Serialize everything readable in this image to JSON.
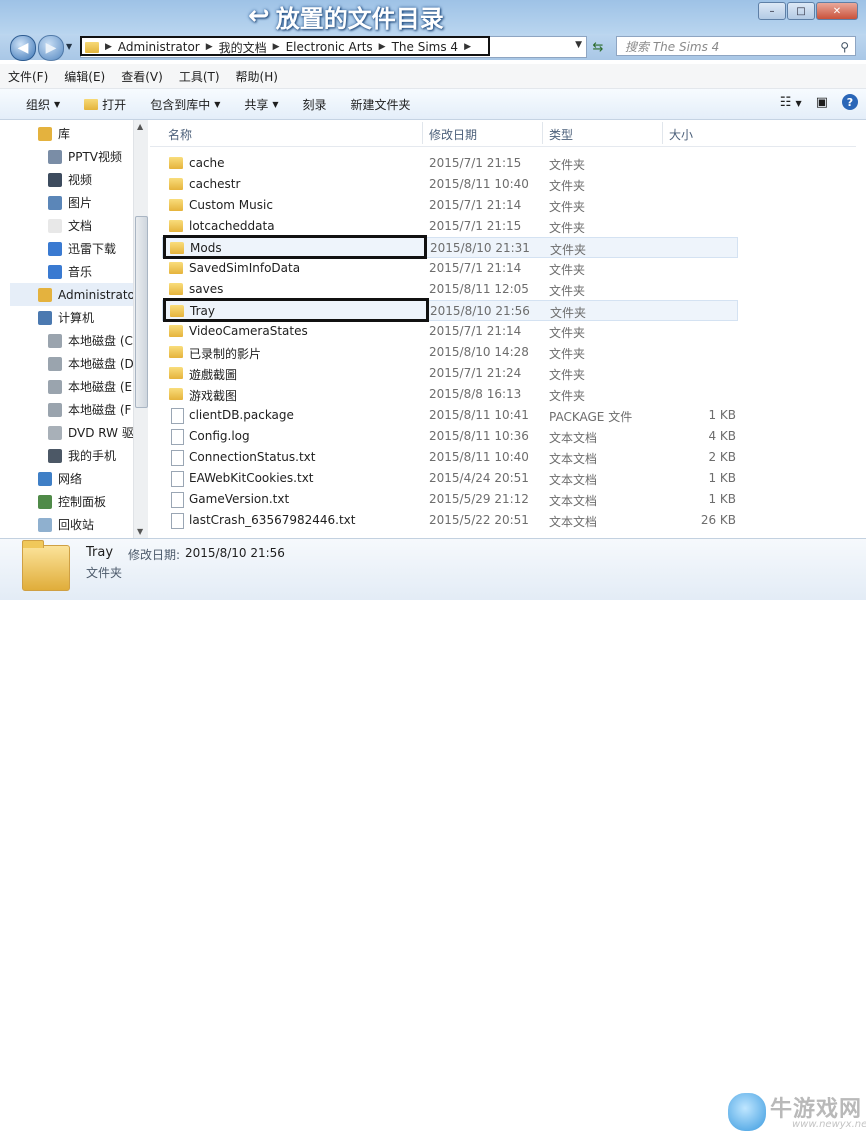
{
  "annotation_title": "放置的文件目录",
  "window_controls": {
    "minimize": "–",
    "maximize": "□",
    "close": "✕"
  },
  "address": {
    "crumbs": [
      "Administrator",
      "我的文档",
      "Electronic Arts",
      "The Sims 4"
    ]
  },
  "search": {
    "placeholder": "搜索 The Sims 4"
  },
  "menu": [
    "文件(F)",
    "编辑(E)",
    "查看(V)",
    "工具(T)",
    "帮助(H)"
  ],
  "toolbar": {
    "organize": "组织",
    "open": "打开",
    "include": "包含到库中",
    "share": "共享",
    "burn": "刻录",
    "new_folder": "新建文件夹"
  },
  "nav": [
    {
      "label": "库",
      "icon": "library-icon",
      "indent": 0
    },
    {
      "label": "PPTV视频",
      "icon": "video-library-icon",
      "indent": 1
    },
    {
      "label": "视频",
      "icon": "video-icon",
      "indent": 1
    },
    {
      "label": "图片",
      "icon": "picture-icon",
      "indent": 1
    },
    {
      "label": "文档",
      "icon": "document-icon",
      "indent": 1
    },
    {
      "label": "迅雷下载",
      "icon": "download-icon",
      "indent": 1
    },
    {
      "label": "音乐",
      "icon": "music-icon",
      "indent": 1
    },
    {
      "label": "Administrator",
      "icon": "user-folder-icon",
      "indent": 0,
      "selected": true
    },
    {
      "label": "计算机",
      "icon": "computer-icon",
      "indent": 0
    },
    {
      "label": "本地磁盘 (C",
      "icon": "drive-icon",
      "indent": 1
    },
    {
      "label": "本地磁盘 (D",
      "icon": "drive-icon",
      "indent": 1
    },
    {
      "label": "本地磁盘 (E",
      "icon": "drive-icon",
      "indent": 1
    },
    {
      "label": "本地磁盘 (F",
      "icon": "drive-icon",
      "indent": 1
    },
    {
      "label": "DVD RW 驱",
      "icon": "dvd-icon",
      "indent": 1
    },
    {
      "label": "我的手机",
      "icon": "phone-icon",
      "indent": 1
    },
    {
      "label": "网络",
      "icon": "network-icon",
      "indent": 0
    },
    {
      "label": "控制面板",
      "icon": "control-panel-icon",
      "indent": 0
    },
    {
      "label": "回收站",
      "icon": "recycle-bin-icon",
      "indent": 0
    }
  ],
  "columns": {
    "name": "名称",
    "date": "修改日期",
    "type": "类型",
    "size": "大小"
  },
  "files": [
    {
      "name": "cache",
      "date": "2015/7/1 21:15",
      "type": "文件夹",
      "size": "",
      "kind": "folder"
    },
    {
      "name": "cachestr",
      "date": "2015/8/11 10:40",
      "type": "文件夹",
      "size": "",
      "kind": "folder"
    },
    {
      "name": "Custom Music",
      "date": "2015/7/1 21:14",
      "type": "文件夹",
      "size": "",
      "kind": "folder"
    },
    {
      "name": "lotcacheddata",
      "date": "2015/7/1 21:15",
      "type": "文件夹",
      "size": "",
      "kind": "folder"
    },
    {
      "name": "Mods",
      "date": "2015/8/10 21:31",
      "type": "文件夹",
      "size": "",
      "kind": "folder",
      "highlighted": true
    },
    {
      "name": "SavedSimInfoData",
      "date": "2015/7/1 21:14",
      "type": "文件夹",
      "size": "",
      "kind": "folder"
    },
    {
      "name": "saves",
      "date": "2015/8/11 12:05",
      "type": "文件夹",
      "size": "",
      "kind": "folder"
    },
    {
      "name": "Tray",
      "date": "2015/8/10 21:56",
      "type": "文件夹",
      "size": "",
      "kind": "folder",
      "highlighted": true
    },
    {
      "name": "VideoCameraStates",
      "date": "2015/7/1 21:14",
      "type": "文件夹",
      "size": "",
      "kind": "folder"
    },
    {
      "name": "已录制的影片",
      "date": "2015/8/10 14:28",
      "type": "文件夹",
      "size": "",
      "kind": "folder"
    },
    {
      "name": "遊戲截圖",
      "date": "2015/7/1 21:24",
      "type": "文件夹",
      "size": "",
      "kind": "folder"
    },
    {
      "name": "游戏截图",
      "date": "2015/8/8 16:13",
      "type": "文件夹",
      "size": "",
      "kind": "folder"
    },
    {
      "name": "clientDB.package",
      "date": "2015/8/11 10:41",
      "type": "PACKAGE 文件",
      "size": "1 KB",
      "kind": "file"
    },
    {
      "name": "Config.log",
      "date": "2015/8/11 10:36",
      "type": "文本文档",
      "size": "4 KB",
      "kind": "file"
    },
    {
      "name": "ConnectionStatus.txt",
      "date": "2015/8/11 10:40",
      "type": "文本文档",
      "size": "2 KB",
      "kind": "file"
    },
    {
      "name": "EAWebKitCookies.txt",
      "date": "2015/4/24 20:51",
      "type": "文本文档",
      "size": "1 KB",
      "kind": "file"
    },
    {
      "name": "GameVersion.txt",
      "date": "2015/5/29 21:12",
      "type": "文本文档",
      "size": "1 KB",
      "kind": "file"
    },
    {
      "name": "lastCrash_63567982446.txt",
      "date": "2015/5/22 20:51",
      "type": "文本文档",
      "size": "26 KB",
      "kind": "file"
    }
  ],
  "details": {
    "name": "Tray",
    "modified_label": "修改日期:",
    "modified_value": "2015/8/10 21:56",
    "type": "文件夹"
  },
  "watermark": {
    "text": "牛游戏网",
    "url": "www.newyx.net"
  },
  "colors": {
    "accent": "#2a66b8",
    "selection": "#eef4fb",
    "folder": "#e5b33c"
  }
}
